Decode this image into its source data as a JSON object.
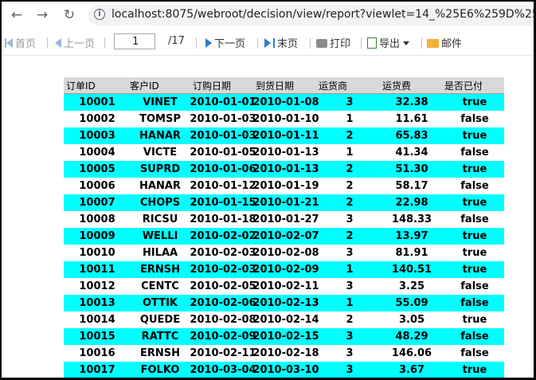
{
  "browser": {
    "url": "localhost:8075/webroot/decision/view/report?viewlet=14_%25E6%259D%25A1",
    "back_icon": "back-arrow-icon",
    "forward_icon": "forward-arrow-icon",
    "reload_icon": "reload-icon"
  },
  "toolbar": {
    "first": "首页",
    "prev": "上一页",
    "page_value": "1",
    "page_total": "/17",
    "next": "下一页",
    "last": "末页",
    "print": "打印",
    "export": "导出",
    "mail": "邮件"
  },
  "table": {
    "headers": [
      "订单ID",
      "客户ID",
      "订购日期",
      "到货日期",
      "运货商",
      "运货费",
      "是否已付"
    ],
    "rows": [
      [
        "10001",
        "VINET",
        "2010-01-01",
        "2010-01-08",
        "3",
        "32.38",
        "true"
      ],
      [
        "10002",
        "TOMSP",
        "2010-01-03",
        "2010-01-10",
        "1",
        "11.61",
        "false"
      ],
      [
        "10003",
        "HANAR",
        "2010-01-03",
        "2010-01-11",
        "2",
        "65.83",
        "true"
      ],
      [
        "10004",
        "VICTE",
        "2010-01-05",
        "2010-01-13",
        "1",
        "41.34",
        "false"
      ],
      [
        "10005",
        "SUPRD",
        "2010-01-06",
        "2010-01-13",
        "2",
        "51.30",
        "true"
      ],
      [
        "10006",
        "HANAR",
        "2010-01-12",
        "2010-01-19",
        "2",
        "58.17",
        "false"
      ],
      [
        "10007",
        "CHOPS",
        "2010-01-15",
        "2010-01-21",
        "2",
        "22.98",
        "true"
      ],
      [
        "10008",
        "RICSU",
        "2010-01-18",
        "2010-01-27",
        "3",
        "148.33",
        "false"
      ],
      [
        "10009",
        "WELLI",
        "2010-02-02",
        "2010-02-07",
        "2",
        "13.97",
        "true"
      ],
      [
        "10010",
        "HILAA",
        "2010-02-03",
        "2010-02-08",
        "3",
        "81.91",
        "true"
      ],
      [
        "10011",
        "ERNSH",
        "2010-02-03",
        "2010-02-09",
        "1",
        "140.51",
        "true"
      ],
      [
        "10012",
        "CENTC",
        "2010-02-05",
        "2010-02-11",
        "3",
        "3.25",
        "false"
      ],
      [
        "10013",
        "OTTIK",
        "2010-02-06",
        "2010-02-13",
        "1",
        "55.09",
        "false"
      ],
      [
        "10014",
        "QUEDE",
        "2010-02-08",
        "2010-02-14",
        "2",
        "3.05",
        "true"
      ],
      [
        "10015",
        "RATTC",
        "2010-02-09",
        "2010-02-15",
        "3",
        "48.29",
        "false"
      ],
      [
        "10016",
        "ERNSH",
        "2010-02-11",
        "2010-02-18",
        "3",
        "146.06",
        "false"
      ],
      [
        "10017",
        "FOLKO",
        "2010-03-04",
        "2010-03-10",
        "3",
        "3.67",
        "true"
      ]
    ]
  },
  "colors": {
    "row_highlight": "#00ffff",
    "row_plain": "#ffffff",
    "header_bg": "#d9d9d9"
  }
}
